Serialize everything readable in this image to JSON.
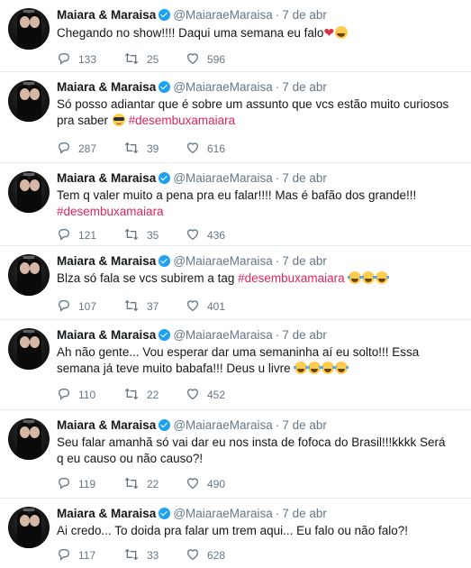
{
  "account": {
    "name": "Maiara & Maraisa",
    "handle": "@MaiaraeMaraisa",
    "dot": "·",
    "date": "7 de abr"
  },
  "colors": {
    "hashtag": "#e0245e",
    "verified": "#1da1f2",
    "meta": "#657786"
  },
  "tweets": [
    {
      "parts": [
        {
          "t": "Chegando no show!!!! Daqui uma semana eu falo"
        }
      ],
      "emojis": [
        "red-heart",
        "smiling-face-with-heart-eyes"
      ],
      "replies": "133",
      "retweets": "25",
      "likes": "596"
    },
    {
      "parts": [
        {
          "t": "Só posso adiantar que é sobre um assunto que vcs estão muito curiosos pra saber "
        }
      ],
      "emojis": [
        "smiling-face-with-sunglasses"
      ],
      "hashtag": "#desembuxamaiara",
      "replies": "287",
      "retweets": "39",
      "likes": "616"
    },
    {
      "parts": [
        {
          "t": "Tem q valer muito a pena pra eu falar!!!! Mas é bafão dos grande!!!"
        }
      ],
      "hashtag": "#desembuxamaiara",
      "replies": "121",
      "retweets": "35",
      "likes": "436"
    },
    {
      "parts": [
        {
          "t": "Blza  só fala se vcs subirem a tag "
        }
      ],
      "hashtag": "#desembuxamaiara",
      "emojis": [
        "tears-of-joy",
        "tears-of-joy",
        "tears-of-joy"
      ],
      "replies": "107",
      "retweets": "37",
      "likes": "401"
    },
    {
      "parts": [
        {
          "t": "Ah não gente... Vou esperar dar uma semaninha aí eu solto!!! Essa semana já teve muito babafa!!! Deus u livre "
        }
      ],
      "emojis": [
        "tears-of-joy",
        "tears-of-joy",
        "tears-of-joy",
        "tears-of-joy"
      ],
      "replies": "110",
      "retweets": "22",
      "likes": "452"
    },
    {
      "parts": [
        {
          "t": "Seu falar amanhã só vai dar eu nos insta de fofoca do Brasil!!!kkkk Será q eu causo ou não causo?!"
        }
      ],
      "replies": "119",
      "retweets": "22",
      "likes": "490"
    },
    {
      "parts": [
        {
          "t": "Ai credo... To doida pra falar um trem aqui... Eu falo ou não falo?!"
        }
      ],
      "replies": "117",
      "retweets": "33",
      "likes": "628"
    }
  ]
}
